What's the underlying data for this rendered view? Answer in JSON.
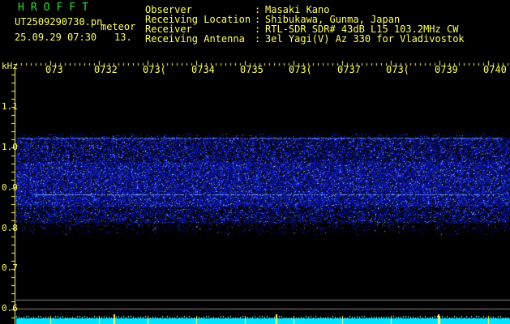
{
  "header": {
    "program": "HROFFT",
    "filename": "UT2509290730.pn",
    "mode": "meteor",
    "datetime": "25.09.29 07:30",
    "count": "13.",
    "info": [
      {
        "key": "Observer",
        "sep": ":",
        "value": "Masaki Kano"
      },
      {
        "key": "Receiving Location",
        "sep": ":",
        "value": "Shibukawa, Gunma, Japan"
      },
      {
        "key": "Receiver",
        "sep": ":",
        "value": "RTL-SDR SDR# 43dB L15 103.2MHz CW"
      },
      {
        "key": "Receiving Antenna",
        "sep": ":",
        "value": "3el Yagi(V) Az 330 for Vladivostok"
      }
    ]
  },
  "axes": {
    "y_unit": "kHz",
    "y_ticks": [
      "1.1",
      "1.0",
      "0.9",
      "0.8",
      "0.7",
      "0.6"
    ],
    "x_ticks": [
      "073",
      "073",
      "073",
      "073",
      "073",
      "073",
      "073",
      "073",
      "073",
      "0740"
    ],
    "x_tick_partial": [
      "",
      "2",
      "(",
      "4",
      "5",
      "(",
      "7",
      "(",
      "9",
      ""
    ]
  },
  "colors": {
    "text": "#ffff66",
    "title": "#33dd33",
    "signal": "#3355ff",
    "baseline": "#00e5ff"
  }
}
